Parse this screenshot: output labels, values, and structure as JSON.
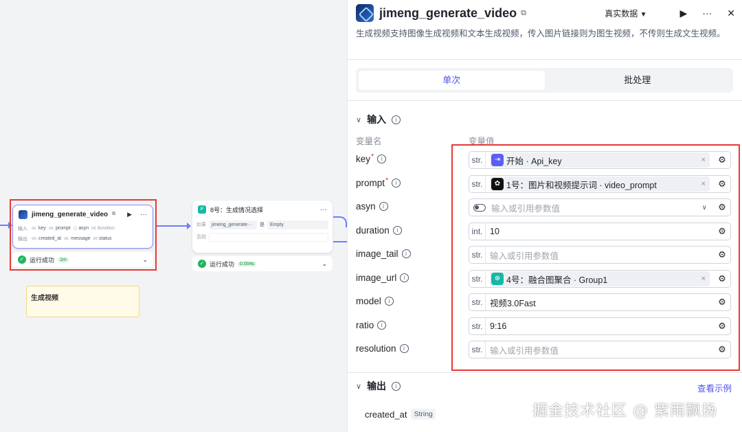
{
  "canvas": {
    "node1": {
      "title": "jimeng_generate_video",
      "input_label": "输入",
      "output_label": "输出",
      "inputs": [
        {
          "type": "str.",
          "name": "key"
        },
        {
          "type": "str.",
          "name": "prompt"
        },
        {
          "type": "bool",
          "name": "asyn"
        },
        {
          "type": "int",
          "name": "duration"
        }
      ],
      "outputs": [
        {
          "type": "str.",
          "name": "created_at"
        },
        {
          "type": "str.",
          "name": "message"
        },
        {
          "type": "int",
          "name": "status"
        }
      ],
      "status_text": "运行成功",
      "time": "1m"
    },
    "node2": {
      "badge": "IF",
      "title": "8号：生成情况选择",
      "if_label": "如果",
      "else_label": "否则",
      "cond_left": "jimeng_generate···",
      "cond_op": "是",
      "cond_right": "Empty",
      "status_text": "运行成功",
      "time": "0.004s"
    },
    "sticky_note": "生成视频"
  },
  "panel": {
    "title": "jimeng_generate_video",
    "mode": "真实数据",
    "description": "生成视频支持图像生成视频和文本生成视频，传入图片链接则为图生视频，不传则生成文生视频。",
    "tabs": [
      "单次",
      "批处理"
    ],
    "input_section": "输入",
    "col_name": "变量名",
    "col_value": "变量值",
    "params": [
      {
        "name": "key",
        "required": true,
        "type": "str.",
        "ref": "开始 · Api_key",
        "ref_color": "#5b5ef5"
      },
      {
        "name": "prompt",
        "required": true,
        "type": "str.",
        "ref": "1号：图片和视频提示词 · video_prompt",
        "ref_color": "#111111"
      },
      {
        "name": "asyn",
        "required": false,
        "type": "",
        "placeholder": "输入或引用参数值"
      },
      {
        "name": "duration",
        "required": false,
        "type": "int.",
        "value": "10"
      },
      {
        "name": "image_tail",
        "required": false,
        "type": "str.",
        "placeholder": "输入或引用参数值"
      },
      {
        "name": "image_url",
        "required": false,
        "type": "str.",
        "ref": "4号：融合图聚合 · Group1",
        "ref_color": "#14b8a6"
      },
      {
        "name": "model",
        "required": false,
        "type": "str.",
        "value": "视频3.0Fast"
      },
      {
        "name": "ratio",
        "required": false,
        "type": "str.",
        "value": "9:16"
      },
      {
        "name": "resolution",
        "required": false,
        "type": "str.",
        "placeholder": "输入或引用参数值"
      }
    ],
    "output_section": "输出",
    "example_link": "查看示例",
    "outputs": [
      {
        "name": "created_at",
        "type": "String"
      }
    ]
  },
  "watermark": "掘金技术社区 @ 紫雨飘扬"
}
